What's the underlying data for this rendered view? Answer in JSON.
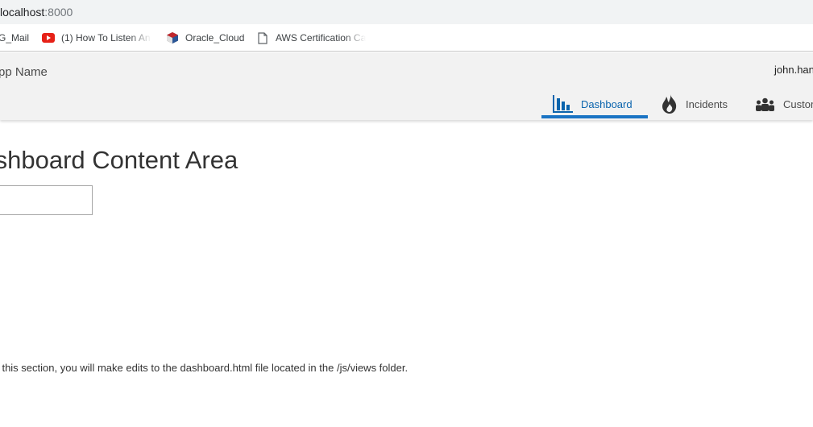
{
  "browser": {
    "url_host": "localhost",
    "url_port": ":8000",
    "bookmarks": [
      {
        "label": "G_Mail",
        "icon": "gmail-icon"
      },
      {
        "label": "(1) How To Listen An",
        "icon": "youtube-icon"
      },
      {
        "label": "Oracle_Cloud",
        "icon": "oracle-cloud-icon"
      },
      {
        "label": "AWS Certification Ca",
        "icon": "page-icon"
      }
    ]
  },
  "header": {
    "app_name": "App Name",
    "user_name": "john.hancock@oracle.com",
    "nav": [
      {
        "label": "Dashboard",
        "icon": "bar-chart-icon",
        "active": true
      },
      {
        "label": "Incidents",
        "icon": "flame-icon",
        "active": false
      },
      {
        "label": "Customers",
        "icon": "people-icon",
        "active": false
      }
    ]
  },
  "content": {
    "title": "Dashboard Content Area",
    "input_value": "",
    "instructions": "In this section, you will make edits to the dashboard.html file located in the /js/views folder."
  },
  "colors": {
    "accent": "#1a74c4",
    "header_bg": "#f2f2f2",
    "address_bar_bg": "#f1f3f4"
  }
}
